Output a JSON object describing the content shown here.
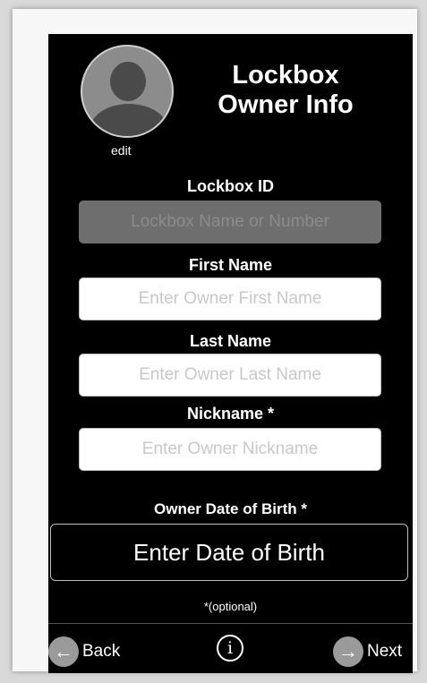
{
  "header": {
    "title_line1": "Lockbox",
    "title_line2": "Owner Info",
    "avatar_edit_label": "edit"
  },
  "form": {
    "lockbox_id": {
      "label": "Lockbox ID",
      "placeholder": "Lockbox Name or Number"
    },
    "first_name": {
      "label": "First Name",
      "placeholder": "Enter Owner First Name"
    },
    "last_name": {
      "label": "Last Name",
      "placeholder": "Enter Owner Last Name"
    },
    "nickname": {
      "label": "Nickname *",
      "placeholder": "Enter Owner Nickname"
    },
    "dob": {
      "label": "Owner Date of Birth *",
      "button_label": "Enter Date of Birth"
    },
    "optional_note": "*(optional)"
  },
  "footer": {
    "back_label": "Back",
    "next_label": "Next",
    "back_icon": "arrow-left-icon",
    "next_icon": "arrow-right-icon",
    "info_icon": "info-icon"
  },
  "colors": {
    "background": "#000000",
    "field_bg": "#ffffff",
    "disabled_field_bg": "#6e6e6e",
    "text": "#ffffff",
    "placeholder": "#c8c8c8"
  }
}
